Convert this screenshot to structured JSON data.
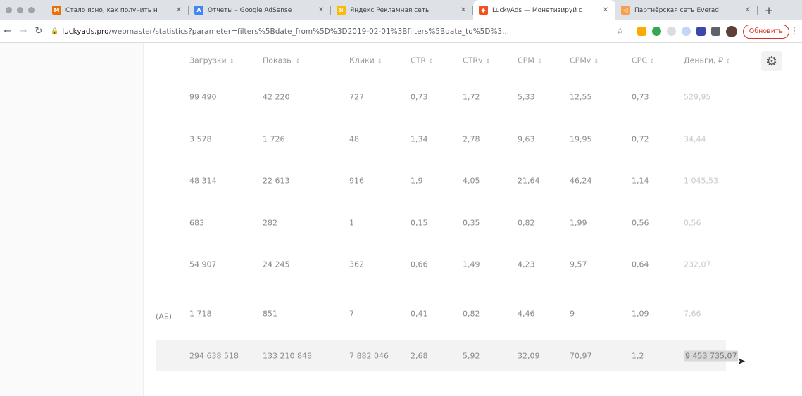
{
  "browser": {
    "tabs": [
      {
        "title": "Стало ясно, как получить н",
        "favicon_color": "#e8710a",
        "favicon_glyph": "M"
      },
      {
        "title": "Отчеты – Google AdSense",
        "favicon_color": "#4285f4",
        "favicon_glyph": "A"
      },
      {
        "title": "Яндекс Рекламная сеть",
        "favicon_color": "#fbbc04",
        "favicon_glyph": "Я"
      },
      {
        "title": "LuckyAds — Монетизируй с",
        "favicon_color": "#f4511e",
        "favicon_glyph": "◆",
        "active": true
      },
      {
        "title": "Партнёрская сеть Everad",
        "favicon_color": "#f6a04d",
        "favicon_glyph": "◁"
      }
    ],
    "url_host": "luckyads.pro",
    "url_path": "/webmaster/statistics?parameter=filters%5Bdate_from%5D%3D2019-02-01%3Bfilters%5Bdate_to%5D%3...",
    "update_label": "Обновить"
  },
  "table": {
    "headers": [
      "Загрузки",
      "Показы",
      "Клики",
      "CTR",
      "CTRv",
      "CPM",
      "CPMv",
      "CPC",
      "Деньги, ₽"
    ],
    "rows": [
      {
        "prefix": "",
        "cells": [
          "99 490",
          "42 220",
          "727",
          "0,73",
          "1,72",
          "5,33",
          "12,55",
          "0,73",
          "529,95"
        ]
      },
      {
        "prefix": "",
        "cells": [
          "3 578",
          "1 726",
          "48",
          "1,34",
          "2,78",
          "9,63",
          "19,95",
          "0,72",
          "34,44"
        ]
      },
      {
        "prefix": "",
        "cells": [
          "48 314",
          "22 613",
          "916",
          "1,9",
          "4,05",
          "21,64",
          "46,24",
          "1,14",
          "1 045,53"
        ]
      },
      {
        "prefix": "",
        "cells": [
          "683",
          "282",
          "1",
          "0,15",
          "0,35",
          "0,82",
          "1,99",
          "0,56",
          "0,56"
        ]
      },
      {
        "prefix": "",
        "cells": [
          "54 907",
          "24 245",
          "362",
          "0,66",
          "1,49",
          "4,23",
          "9,57",
          "0,64",
          "232,07"
        ]
      },
      {
        "prefix": "(AE)",
        "cells": [
          "1 718",
          "851",
          "7",
          "0,41",
          "0,82",
          "4,46",
          "9",
          "1,09",
          "7,66"
        ]
      }
    ],
    "total": {
      "cells": [
        "294 638 518",
        "133 210 848",
        "7 882 046",
        "2,68",
        "5,92",
        "32,09",
        "70,97",
        "1,2",
        "9 453 735,07"
      ]
    }
  }
}
